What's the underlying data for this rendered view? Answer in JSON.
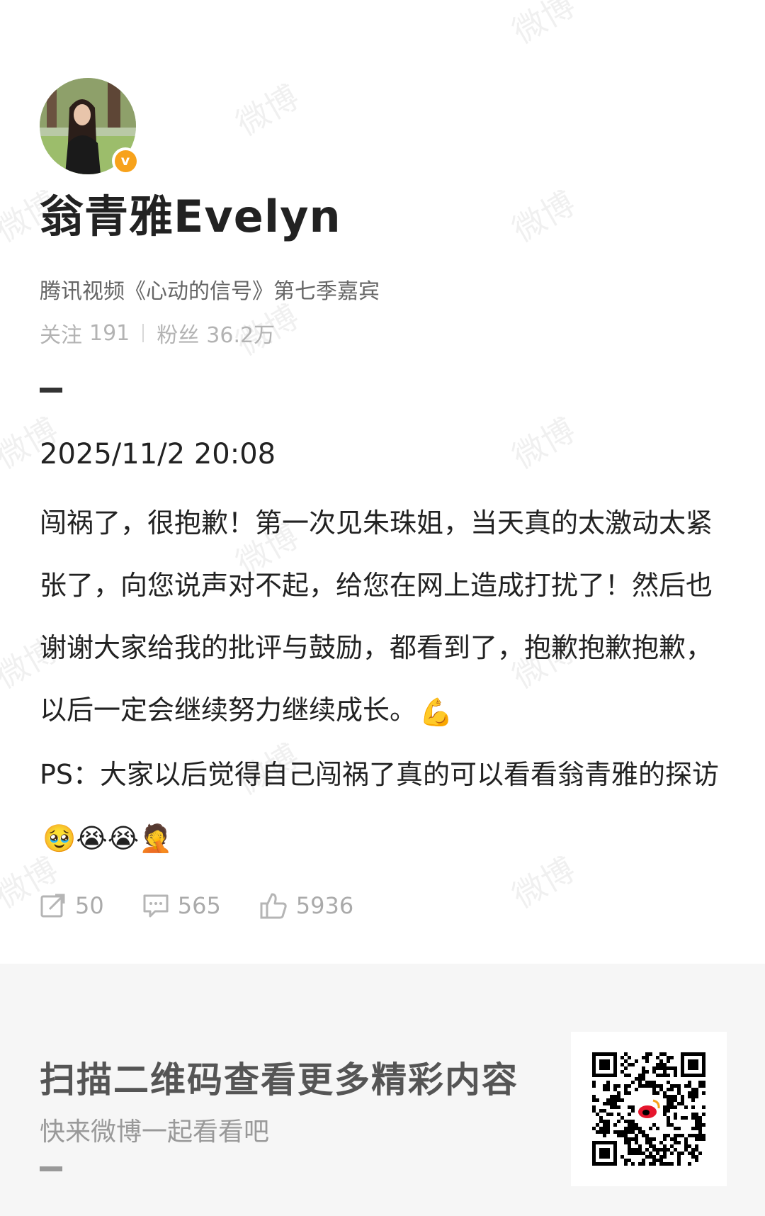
{
  "watermark_text": "微博",
  "profile": {
    "name": "翁青雅Evelyn",
    "description": "腾讯视频《心动的信号》第七季嘉宾",
    "following_label": "关注",
    "following_count": "191",
    "followers_label": "粉丝",
    "followers_count": "36.2万",
    "verify_symbol": "v"
  },
  "post": {
    "time": "2025/11/2 20:08",
    "text_main": "闯祸了，很抱歉！第一次见朱珠姐，当天真的太激动太紧张了，向您说声对不起，给您在网上造成打扰了！然后也谢谢大家给我的批评与鼓励，都看到了，抱歉抱歉抱歉，以后一定会继续努力继续成长。",
    "text_emoji_1": "💪",
    "text_ps": "PS：大家以后觉得自己闯祸了真的可以看看翁青雅的探访",
    "text_emoji_2": "🥹😭😭🤦",
    "reposts": "50",
    "comments": "565",
    "likes": "5936"
  },
  "promo": {
    "title": "扫描二维码查看更多精彩内容",
    "subtitle": "快来微博一起看看吧"
  },
  "colors": {
    "verify": "#f7a21b",
    "text": "#222222",
    "muted": "#aaaaaa",
    "promo_bg": "#f6f6f6"
  }
}
